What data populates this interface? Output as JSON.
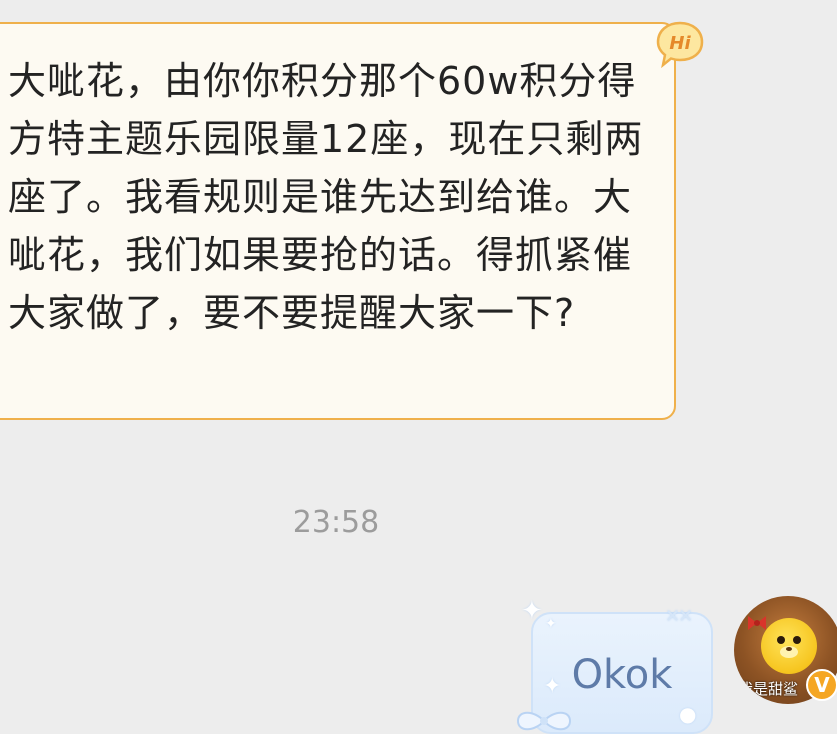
{
  "messages": {
    "incoming": {
      "text": "大呲花，由你你积分那个60w积分得方特主题乐园限量12座，现在只剩两座了。我看规则是谁先达到给谁。大呲花，我们如果要抢的话。得抓紧催大家做了，要不要提醒大家一下?",
      "badge_text": "Hi"
    },
    "timestamp": "23:58",
    "outgoing": {
      "text": "Okok"
    }
  },
  "sender": {
    "avatar_label": "我是甜鲨",
    "vip_badge": "V"
  },
  "colors": {
    "background": "#ededed",
    "incoming_bubble": "#fdfaf2",
    "incoming_border": "#efb04b",
    "outgoing_bubble": "#dbeafb",
    "outgoing_text": "#5e7ba8",
    "vip": "#f5a623"
  }
}
